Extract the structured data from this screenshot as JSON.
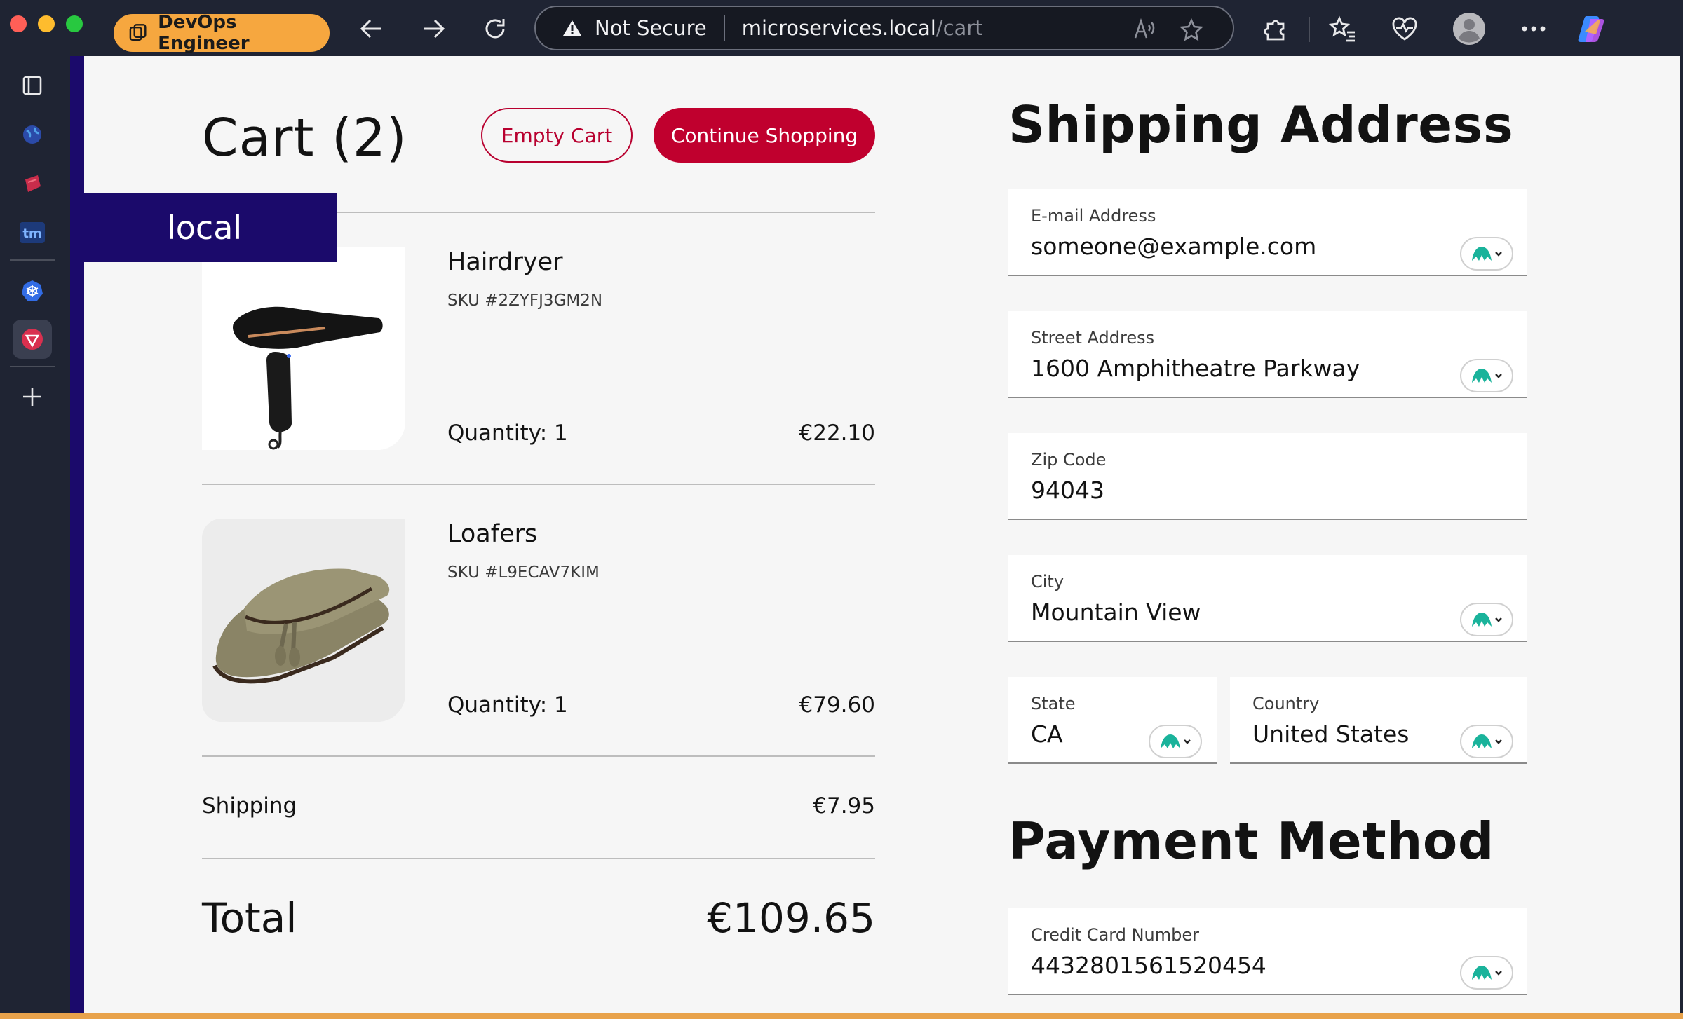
{
  "browser": {
    "profile_label": "DevOps Engineer",
    "not_secure_label": "Not Secure",
    "url_host": "microservices.local",
    "url_path": "/cart"
  },
  "page": {
    "env_badge": "local",
    "cart": {
      "title": "Cart (2)",
      "empty_cart_label": "Empty Cart",
      "continue_shopping_label": "Continue Shopping",
      "items": [
        {
          "name": "Hairdryer",
          "sku": "SKU #2ZYFJ3GM2N",
          "quantity": "Quantity: 1",
          "price": "€22.10"
        },
        {
          "name": "Loafers",
          "sku": "SKU #L9ECAV7KIM",
          "quantity": "Quantity: 1",
          "price": "€79.60"
        }
      ],
      "shipping_label": "Shipping",
      "shipping_price": "€7.95",
      "total_label": "Total",
      "total_price": "€109.65"
    },
    "shipping_address": {
      "title": "Shipping Address",
      "email_label": "E-mail Address",
      "email_value": "someone@example.com",
      "street_label": "Street Address",
      "street_value": "1600 Amphitheatre Parkway",
      "zip_label": "Zip Code",
      "zip_value": "94043",
      "city_label": "City",
      "city_value": "Mountain View",
      "state_label": "State",
      "state_value": "CA",
      "country_label": "Country",
      "country_value": "United States"
    },
    "payment": {
      "title": "Payment Method",
      "card_label": "Credit Card Number",
      "card_value": "4432801561520454"
    }
  },
  "colors": {
    "accent": "#c0002e",
    "env_badge_bg": "#1b0a6b",
    "profile_pill": "#f6a73f"
  }
}
